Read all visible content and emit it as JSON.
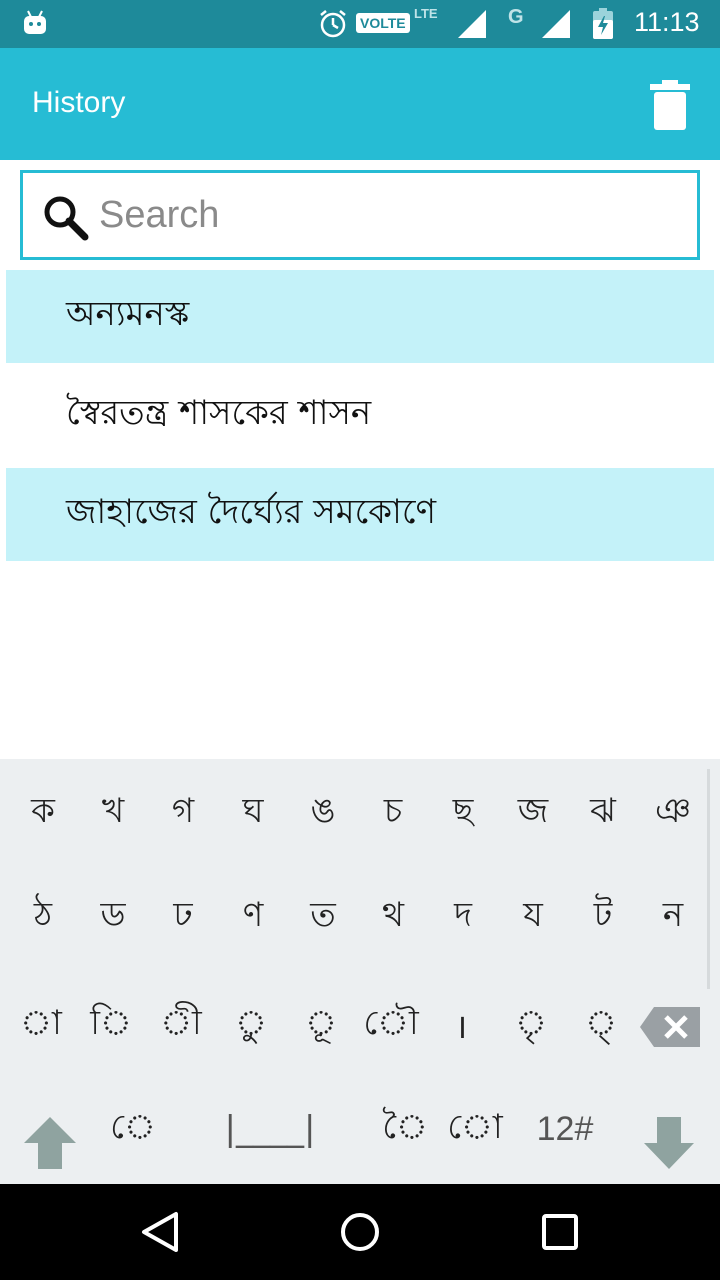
{
  "status_bar": {
    "time": "11:13",
    "volte_label": "VOLTE",
    "lte_label": "LTE",
    "network_label": "G"
  },
  "app_bar": {
    "title": "History",
    "delete_icon": "trash-icon"
  },
  "search": {
    "placeholder": "Search",
    "value": "",
    "icon": "search-icon"
  },
  "history": {
    "items": [
      {
        "text": "অন্যমনস্ক",
        "highlighted": true
      },
      {
        "text": "স্বৈরতন্ত্র শাসকের শাসন",
        "highlighted": false
      },
      {
        "text": "জাহাজের দৈর্ঘ্যের সমকোণে",
        "highlighted": true
      }
    ]
  },
  "keyboard": {
    "row1": [
      "ক",
      "খ",
      "গ",
      "ঘ",
      "ঙ",
      "চ",
      "ছ",
      "জ",
      "ঝ",
      "ঞ"
    ],
    "row2": [
      "ঠ",
      "ড",
      "ঢ",
      "ণ",
      "ত",
      "থ",
      "দ",
      "য",
      "ট",
      "ন"
    ],
    "row3": [
      "◌া",
      "◌ি",
      "◌ী",
      "◌ু",
      "◌ূ",
      "◌ৌ",
      "।",
      "◌ৃ",
      "◌্"
    ],
    "row4": {
      "e_sign": "◌ে",
      "space": "|____|",
      "ai_sign": "◌ৈ",
      "o_sign": "◌ো",
      "numbers": "12#"
    },
    "icons": {
      "backspace": "backspace-icon",
      "shift": "shift-up-icon",
      "hide": "hide-keyboard-icon"
    }
  },
  "nav_bar": {
    "back": "back-icon",
    "home": "home-icon",
    "recents": "recents-icon"
  },
  "colors": {
    "status_bar": "#1e8a9a",
    "app_bar": "#26bcd4",
    "highlight_row": "#c4f2f9",
    "keyboard_bg": "#eceff1"
  }
}
